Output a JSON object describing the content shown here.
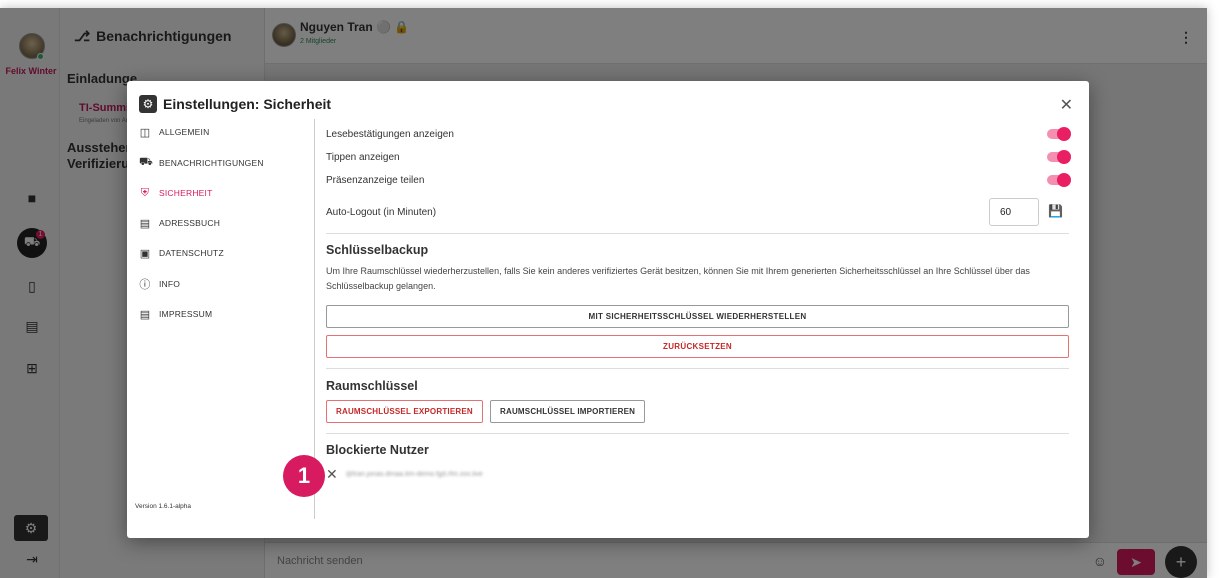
{
  "rail": {
    "user_name": "Felix Winter",
    "icons": [
      "chat-icon",
      "bell-icon",
      "phone-icon",
      "contacts-icon",
      "add-icon"
    ],
    "bell_badge": "1",
    "settings_icon": "gear-icon",
    "logout_icon": "logout-icon"
  },
  "notifications": {
    "header": "Benachrichtigungen",
    "invitations_heading": "Einladunge",
    "invite_title": "TI-Summit E",
    "invite_sub": "Eingeladen von Am",
    "pending_heading_line1": "Ausstehen",
    "pending_heading_line2": "Verifizieru"
  },
  "chat": {
    "room_name": "Nguyen Tran",
    "room_members": "2 Mitglieder",
    "composer_placeholder": "Nachricht senden"
  },
  "dialog": {
    "title": "Einstellungen: Sicherheit",
    "nav": [
      {
        "label": "ALLGEMEIN",
        "icon": "general-icon"
      },
      {
        "label": "BENACHRICHTIGUNGEN",
        "icon": "bell-icon"
      },
      {
        "label": "SICHERHEIT",
        "icon": "shield-icon"
      },
      {
        "label": "ADRESSBUCH",
        "icon": "addressbook-icon"
      },
      {
        "label": "DATENSCHUTZ",
        "icon": "lock-icon"
      },
      {
        "label": "INFO",
        "icon": "info-icon"
      },
      {
        "label": "IMPRESSUM",
        "icon": "document-icon"
      }
    ],
    "active_nav": "SICHERHEIT",
    "version": "Version 1.6.1-alpha",
    "settings": {
      "read_receipts": "Lesebestätigungen anzeigen",
      "typing": "Tippen anzeigen",
      "presence": "Präsenzanzeige teilen",
      "auto_logout": "Auto-Logout (in Minuten)",
      "auto_logout_value": "60"
    },
    "toggles": {
      "read_receipts": true,
      "typing": true,
      "presence": true
    },
    "key_backup": {
      "heading": "Schlüsselbackup",
      "description": "Um Ihre Raumschlüssel wiederherzustellen, falls Sie kein anderes verifiziertes Gerät besitzen, können Sie mit Ihrem generierten Sicherheitsschlüssel an Ihre Schlüssel über das Schlüsselbackup gelangen.",
      "restore_button": "MIT SICHERHEITSSCHLÜSSEL WIEDERHERSTELLEN",
      "reset_button": "ZURÜCKSETZEN"
    },
    "room_keys": {
      "heading": "Raumschlüssel",
      "export_button": "RAUMSCHLÜSSEL EXPORTIEREN",
      "import_button": "RAUMSCHLÜSSEL IMPORTIEREN"
    },
    "blocked": {
      "heading": "Blockierte Nutzer",
      "user": "@tran.jonas.dmaa.tim-demo.fgd.rfm.xxx.live"
    }
  },
  "annotation_marker": "1",
  "colors": {
    "accent": "#d81b60",
    "danger": "#c62828"
  }
}
